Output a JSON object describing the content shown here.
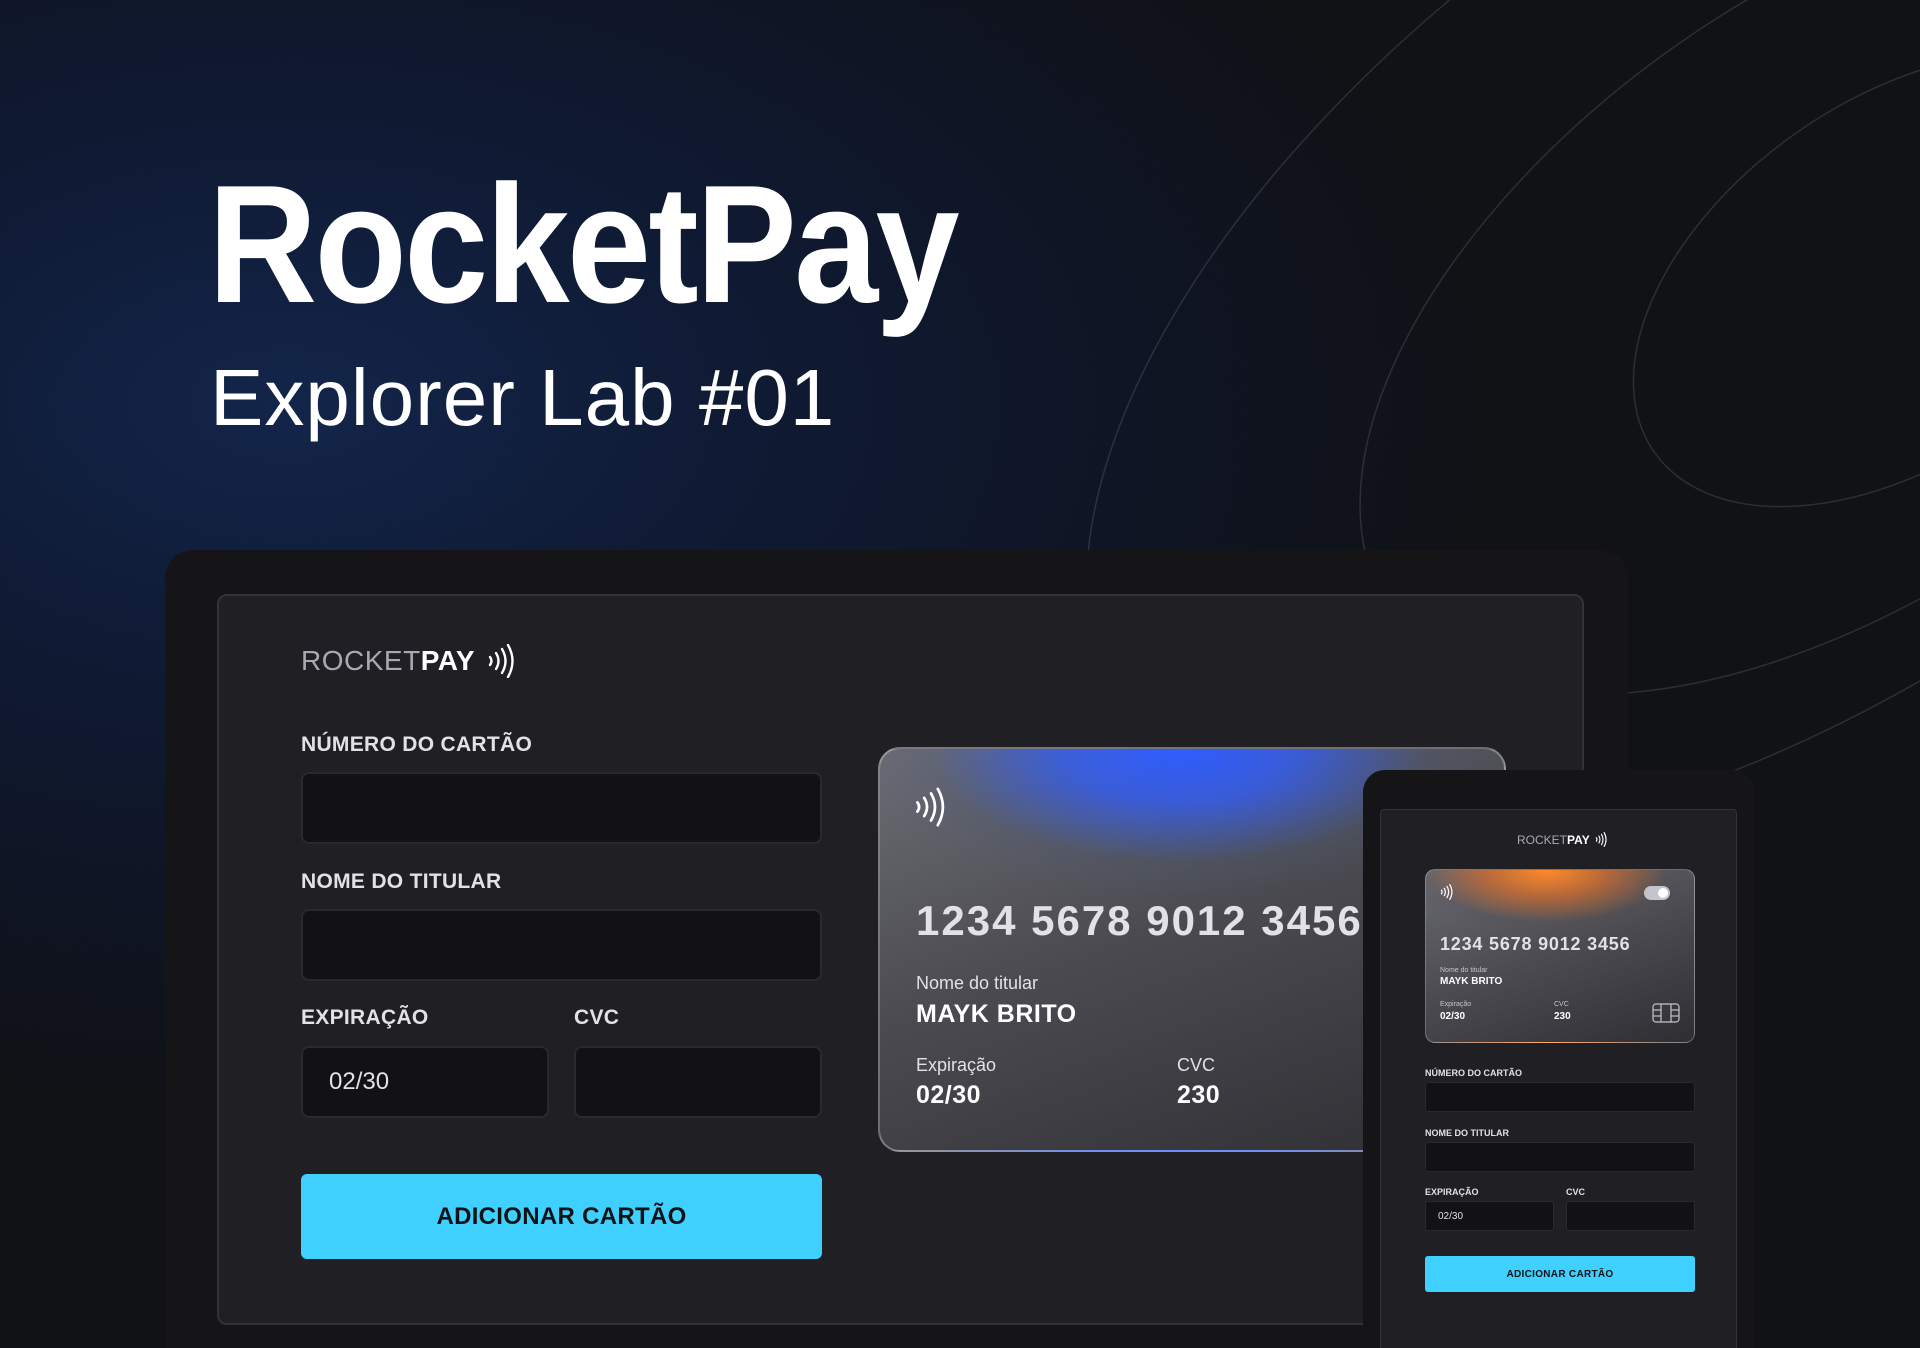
{
  "hero": {
    "title": "RocketPay",
    "subtitle": "Explorer Lab #01"
  },
  "brand": {
    "logo_light": "ROCKET",
    "logo_bold": "PAY",
    "accent_color": "#3fd0ff"
  },
  "form": {
    "card_number_label": "NÚMERO DO CARTÃO",
    "card_number_value": "",
    "holder_name_label": "NOME DO TITULAR",
    "holder_name_value": "",
    "expiration_label": "EXPIRAÇÃO",
    "expiration_value": "02/30",
    "cvc_label": "CVC",
    "cvc_value": "",
    "submit_label": "ADICIONAR CARTÃO"
  },
  "card_preview": {
    "number": "1234 5678 9012 3456",
    "holder_label": "Nome do titular",
    "holder_name": "MAYK BRITO",
    "expiration_label": "Expiração",
    "expiration_value": "02/30",
    "cvc_label": "CVC",
    "cvc_value": "230"
  },
  "mobile": {
    "card": {
      "number": "1234 5678 9012 3456",
      "holder_label": "Nome do titular",
      "holder_name": "MAYK BRITO",
      "expiration_label": "Expiração",
      "expiration_value": "02/30",
      "cvc_label": "CVC",
      "cvc_value": "230"
    },
    "form": {
      "card_number_label": "NÚMERO DO CARTÃO",
      "holder_name_label": "NOME DO TITULAR",
      "expiration_label": "EXPIRAÇÃO",
      "expiration_value": "02/30",
      "cvc_label": "CVC",
      "submit_label": "ADICIONAR CARTÃO"
    }
  }
}
